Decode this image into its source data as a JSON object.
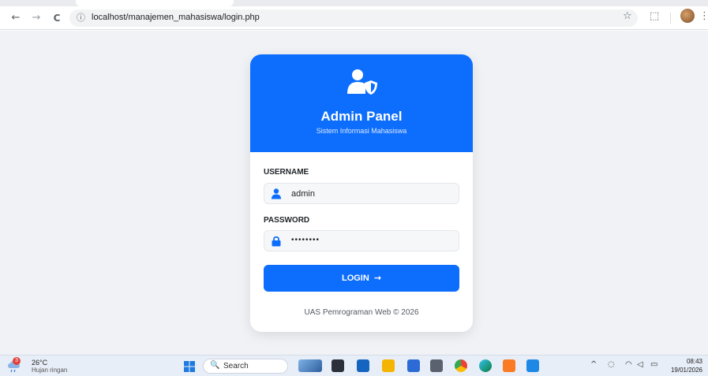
{
  "browser": {
    "url": "localhost/manajemen_mahasiswa/login.php",
    "back_glyph": "←",
    "forward_glyph": "→",
    "reload_glyph": "C",
    "info_glyph": "ⓘ",
    "star_glyph": "☆",
    "extensions_glyph": "⬚",
    "menu_glyph": "⋮"
  },
  "login": {
    "title": "Admin Panel",
    "subtitle": "Sistem Informasi Mahasiswa",
    "username_label": "USERNAME",
    "username_value": "admin",
    "password_label": "PASSWORD",
    "password_value": "••••••••",
    "button_label": "LOGIN",
    "button_arrow": "→",
    "footer": "UAS Pemrograman Web © 2026",
    "accent_color": "#0d6efd"
  },
  "taskbar": {
    "weather_badge": "3",
    "temperature": "26°C",
    "weather_desc": "Hujan ringan",
    "search_label": "Search",
    "search_glyph": "🔍",
    "tray_chevron": "^",
    "time": "08:43",
    "date": "19/01/2026"
  }
}
